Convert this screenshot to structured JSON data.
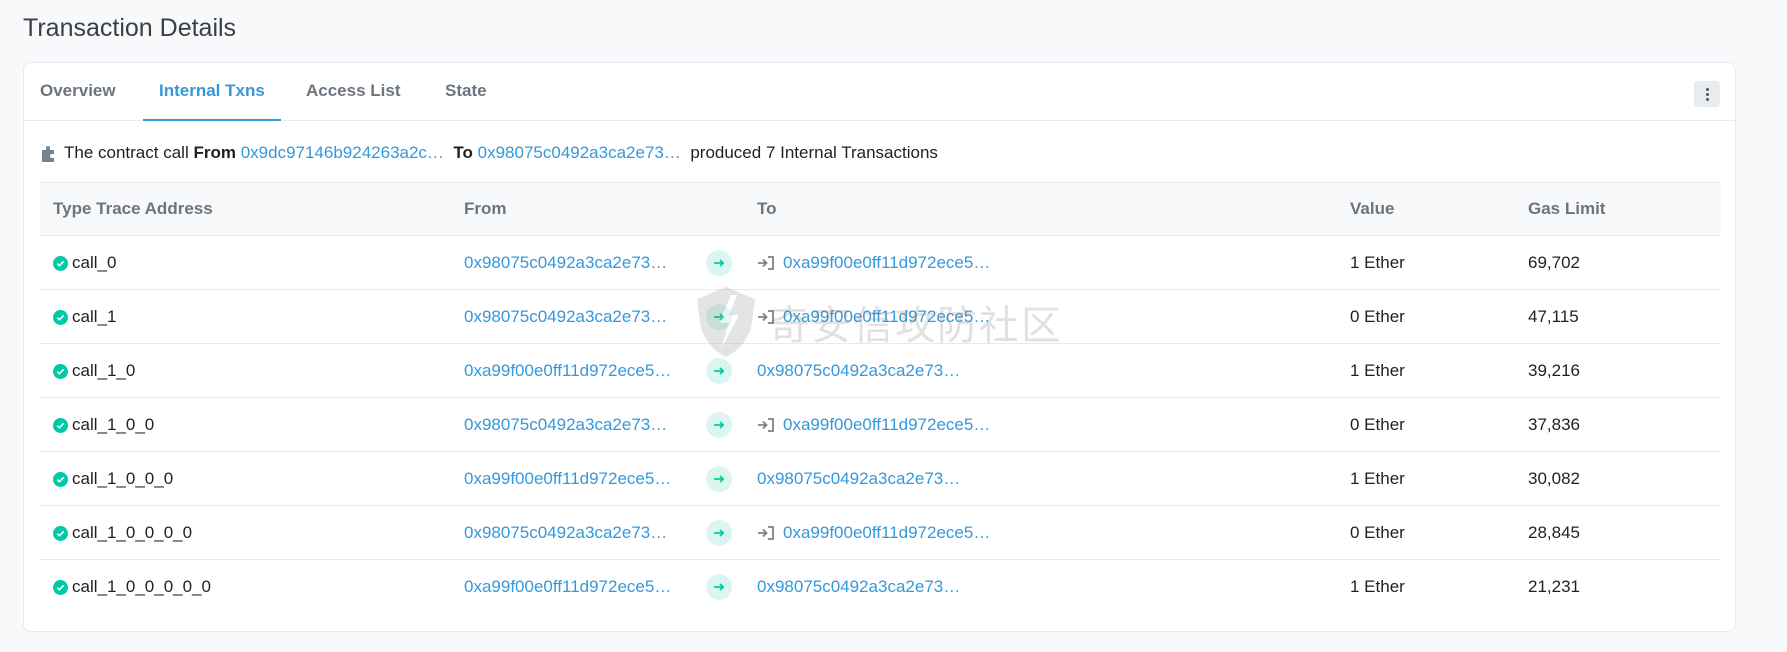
{
  "page_title": "Transaction Details",
  "tabs": [
    {
      "label": "Overview",
      "active": false
    },
    {
      "label": "Internal Txns",
      "active": true
    },
    {
      "label": "Access List",
      "active": false
    },
    {
      "label": "State",
      "active": false
    }
  ],
  "summary": {
    "prefix": "The contract call",
    "from_label": "From",
    "from_address": "0x9dc97146b924263a2c…",
    "to_label": "To",
    "to_address": "0x98075c0492a3ca2e73…",
    "suffix": "produced 7 Internal Transactions",
    "icon": "puzzle-icon"
  },
  "columns": [
    "Type Trace Address",
    "From",
    "To",
    "Value",
    "Gas Limit"
  ],
  "rows": [
    {
      "type": "call_0",
      "from": "0x98075c0492a3ca2e73…",
      "to": "0xa99f00e0ff11d972ece5…",
      "to_is_contract": true,
      "value": "1 Ether",
      "gas": "69,702"
    },
    {
      "type": "call_1",
      "from": "0x98075c0492a3ca2e73…",
      "to": "0xa99f00e0ff11d972ece5…",
      "to_is_contract": true,
      "value": "0 Ether",
      "gas": "47,115"
    },
    {
      "type": "call_1_0",
      "from": "0xa99f00e0ff11d972ece5…",
      "to": "0x98075c0492a3ca2e73…",
      "to_is_contract": false,
      "value": "1 Ether",
      "gas": "39,216"
    },
    {
      "type": "call_1_0_0",
      "from": "0x98075c0492a3ca2e73…",
      "to": "0xa99f00e0ff11d972ece5…",
      "to_is_contract": true,
      "value": "0 Ether",
      "gas": "37,836"
    },
    {
      "type": "call_1_0_0_0",
      "from": "0xa99f00e0ff11d972ece5…",
      "to": "0x98075c0492a3ca2e73…",
      "to_is_contract": false,
      "value": "1 Ether",
      "gas": "30,082"
    },
    {
      "type": "call_1_0_0_0_0",
      "from": "0x98075c0492a3ca2e73…",
      "to": "0xa99f00e0ff11d972ece5…",
      "to_is_contract": true,
      "value": "0 Ether",
      "gas": "28,845"
    },
    {
      "type": "call_1_0_0_0_0_0",
      "from": "0xa99f00e0ff11d972ece5…",
      "to": "0x98075c0492a3ca2e73…",
      "to_is_contract": false,
      "value": "1 Ether",
      "gas": "21,231"
    }
  ],
  "watermark": {
    "text": "奇安信攻防社区"
  },
  "colors": {
    "link": "#3498db",
    "success": "#00c9a7",
    "arrow_bg": "#daf6ef"
  }
}
